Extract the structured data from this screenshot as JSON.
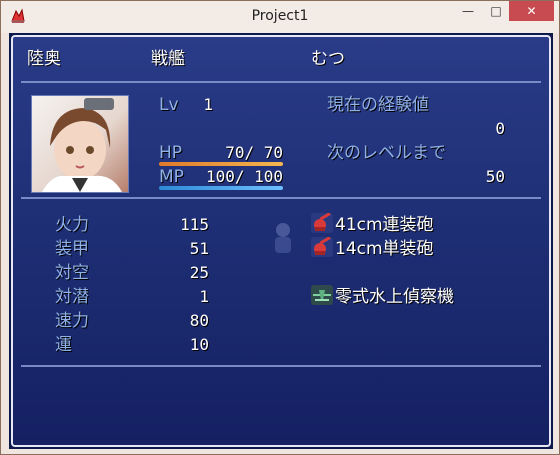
{
  "window": {
    "title": "Project1",
    "controls": {
      "minimize": "—",
      "maximize": "□",
      "close": "✕"
    }
  },
  "header": {
    "name": "陸奥",
    "class": "戦艦",
    "nickname": "むつ"
  },
  "status": {
    "level_label": "Lv",
    "level_value": "1",
    "hp_label": "HP",
    "hp_text": "70/ 70",
    "mp_label": "MP",
    "mp_text": "100/ 100",
    "exp_label": "現在の経験値",
    "exp_value": "0",
    "next_label": "次のレベルまで",
    "next_value": "50",
    "hp_fill": 1.0,
    "mp_fill": 1.0
  },
  "params": [
    {
      "label": "火力",
      "value": "115"
    },
    {
      "label": "装甲",
      "value": "51"
    },
    {
      "label": "対空",
      "value": "25"
    },
    {
      "label": "対潜",
      "value": "1"
    },
    {
      "label": "速力",
      "value": "80"
    },
    {
      "label": "運",
      "value": "10"
    }
  ],
  "equipment": [
    {
      "name": "41cm連装砲",
      "icon": "red-gun-icon"
    },
    {
      "name": "14cm単装砲",
      "icon": "red-gun-icon"
    },
    {
      "name": "",
      "icon": ""
    },
    {
      "name": "零式水上偵察機",
      "icon": "seaplane-icon"
    }
  ],
  "colors": {
    "panel_top": "#2a3b88",
    "panel_bottom": "#142062",
    "label": "#8fb1e6",
    "hp": "#e07a2b",
    "mp": "#2e8ad6",
    "close": "#c74b50"
  }
}
